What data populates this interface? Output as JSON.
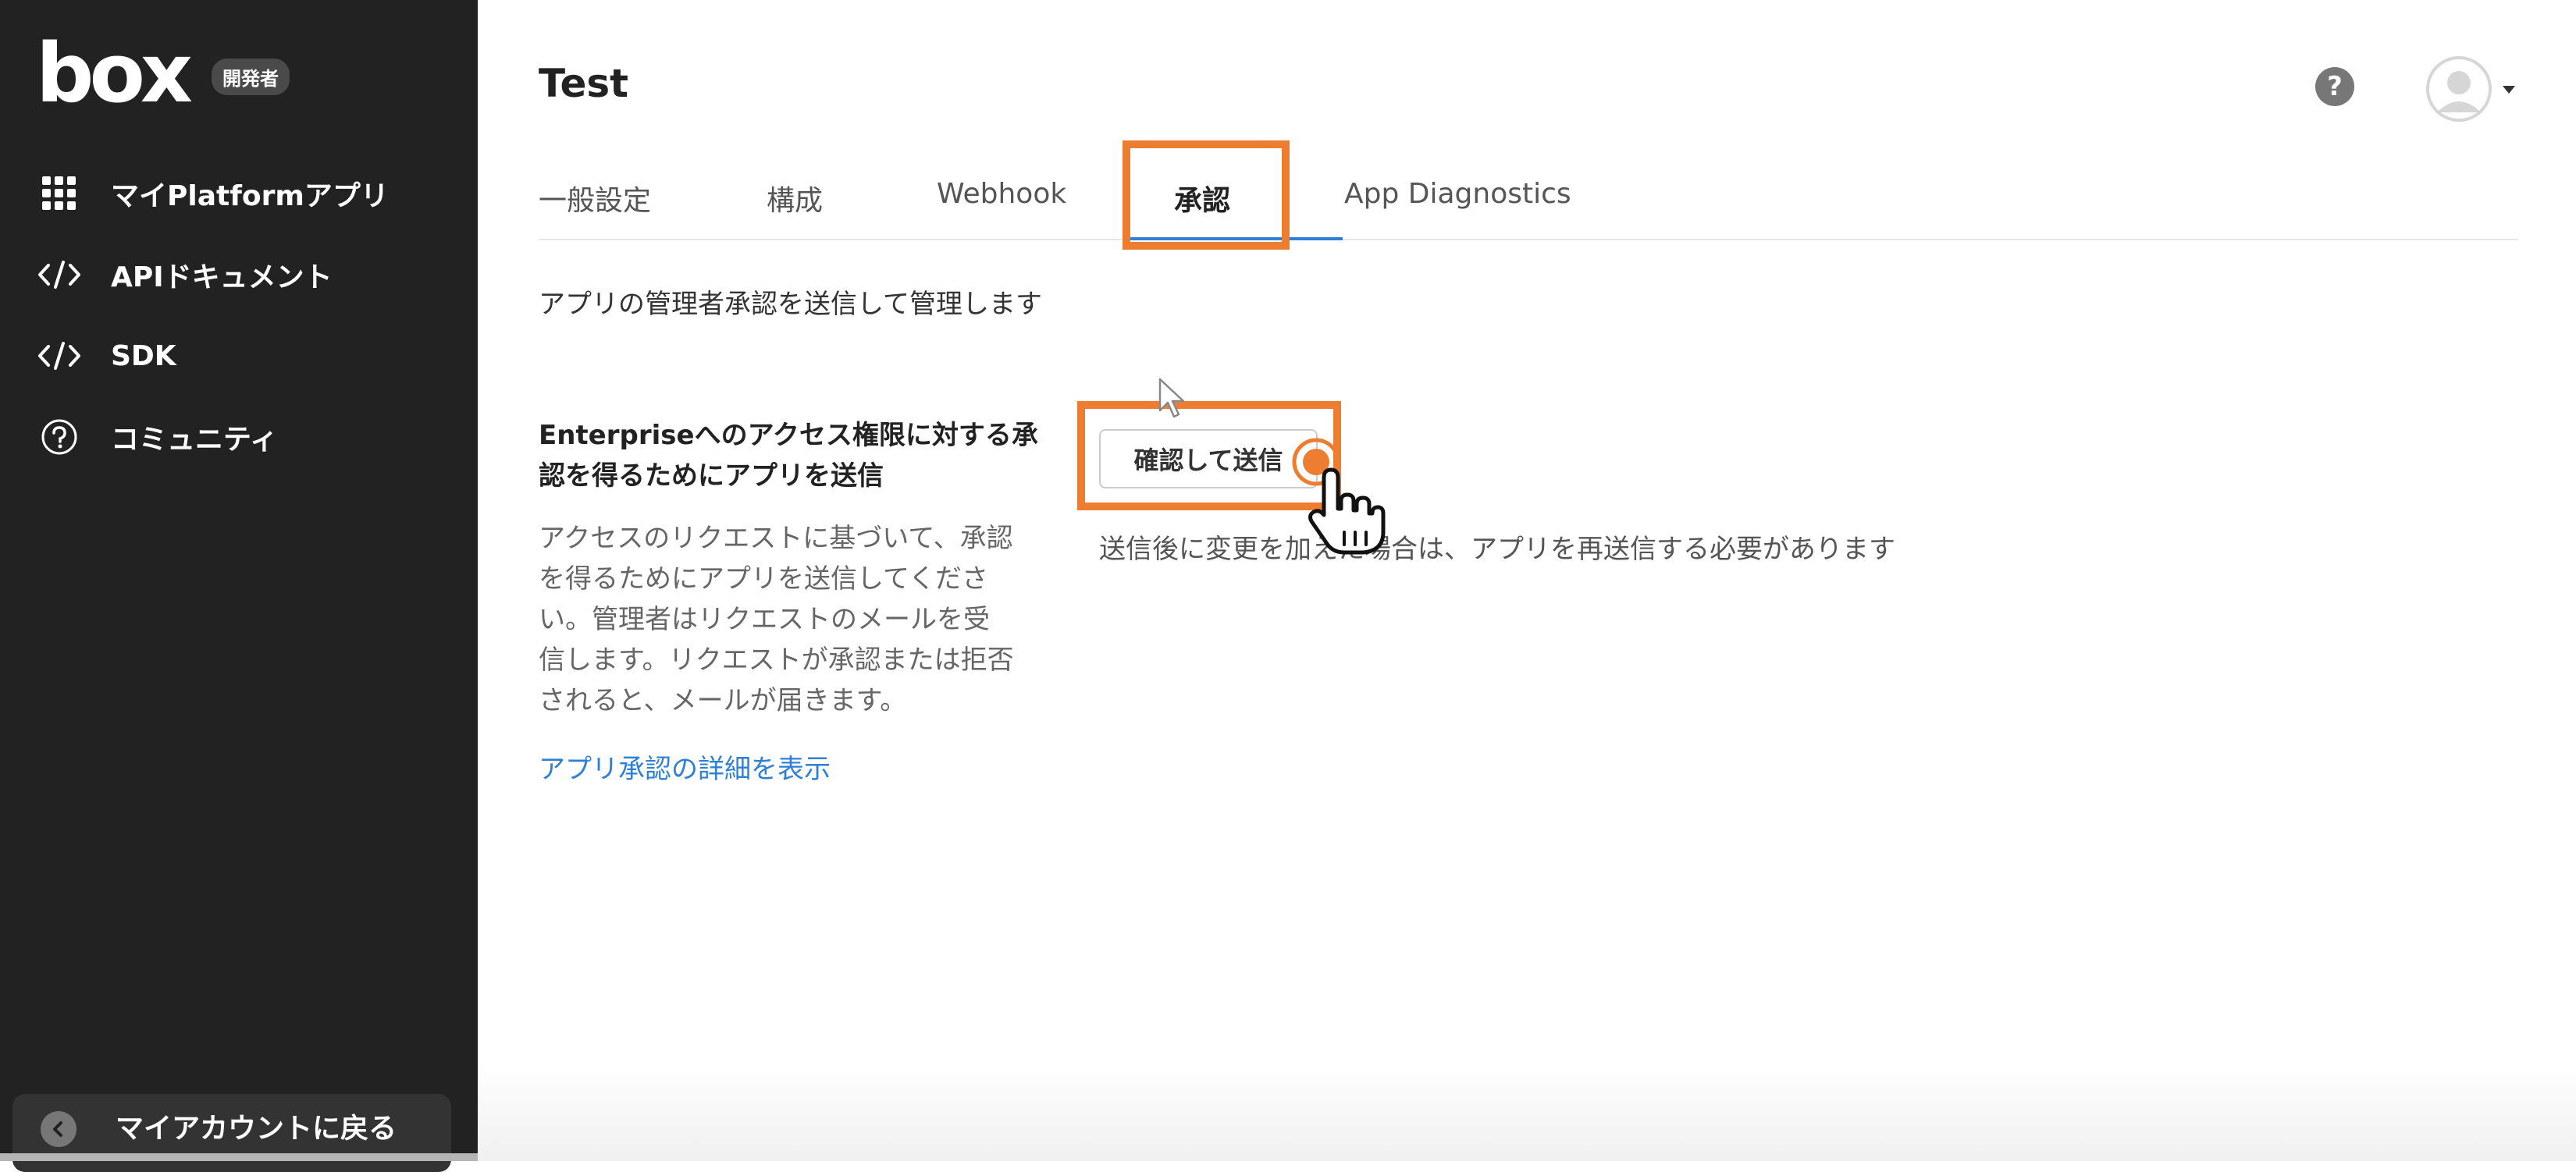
{
  "sidebar": {
    "logo_text": "box",
    "badge": "開発者",
    "items": [
      {
        "label": "マイPlatformアプリ",
        "icon": "grid-icon"
      },
      {
        "label": "APIドキュメント",
        "icon": "code-icon"
      },
      {
        "label": "SDK",
        "icon": "code-icon"
      },
      {
        "label": "コミュニティ",
        "icon": "question-circle-icon"
      }
    ],
    "back_label": "マイアカウントに戻る"
  },
  "header": {
    "title": "Test",
    "help_icon": "question-circle-icon"
  },
  "tabs": [
    {
      "label": "一般設定"
    },
    {
      "label": "構成"
    },
    {
      "label": "Webhook"
    },
    {
      "label": "承認",
      "active": true
    },
    {
      "label": "App Diagnostics"
    }
  ],
  "main": {
    "subtitle": "アプリの管理者承認を送信して管理します",
    "section_title": "Enterpriseへのアクセス権限に対する承認を得るためにアプリを送信",
    "section_desc": "アクセスのリクエストに基づいて、承認を得るためにアプリを送信してください。管理者はリクエストのメールを受信します。リクエストが承認または拒否されると、メールが届きます。",
    "details_link": "アプリ承認の詳細を表示",
    "confirm_button": "確認して送信",
    "note": "送信後に変更を加えた場合は、アプリを再送信する必要があります"
  },
  "colors": {
    "sidebar_bg": "#222222",
    "highlight": "#ed7d31",
    "link": "#2f7fd6",
    "tab_indicator": "#2f7fd6"
  }
}
